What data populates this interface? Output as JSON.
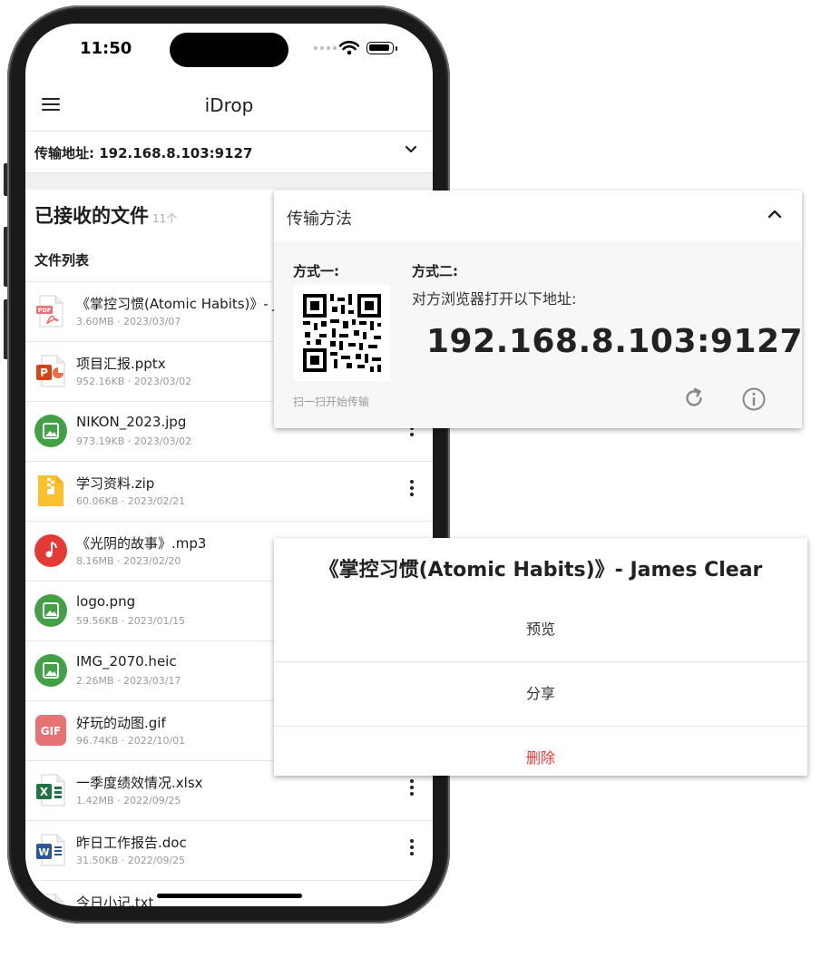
{
  "status": {
    "time": "11:50"
  },
  "app": {
    "title": "iDrop"
  },
  "address": {
    "label": "传输地址: 192.168.8.103:9127"
  },
  "received": {
    "title": "已接收的文件",
    "count": "11个",
    "list_header": "文件列表"
  },
  "files": [
    {
      "name": "《掌控习惯(Atomic Habits)》- James Clear.pdf",
      "meta": "3.60MB · 2023/03/07",
      "icon": "pdf-file-icon"
    },
    {
      "name": "项目汇报.pptx",
      "meta": "952.16KB · 2023/03/02",
      "icon": "pptx-file-icon"
    },
    {
      "name": "NIKON_2023.jpg",
      "meta": "973.19KB · 2023/03/02",
      "icon": "image-file-icon"
    },
    {
      "name": "学习资料.zip",
      "meta": "60.06KB · 2023/02/21",
      "icon": "zip-file-icon"
    },
    {
      "name": "《光阴的故事》.mp3",
      "meta": "8.16MB · 2023/02/20",
      "icon": "music-file-icon"
    },
    {
      "name": "logo.png",
      "meta": "59.56KB · 2023/01/15",
      "icon": "image-file-icon"
    },
    {
      "name": "IMG_2070.heic",
      "meta": "2.26MB · 2023/03/17",
      "icon": "image-file-icon"
    },
    {
      "name": "好玩的动图.gif",
      "meta": "96.74KB · 2022/10/01",
      "icon": "gif-file-icon"
    },
    {
      "name": "一季度绩效情况.xlsx",
      "meta": "1.42MB · 2022/09/25",
      "icon": "xlsx-file-icon"
    },
    {
      "name": "昨日工作报告.doc",
      "meta": "31.50KB · 2022/09/25",
      "icon": "doc-file-icon"
    },
    {
      "name": "今日小记.txt",
      "meta": "",
      "icon": "txt-file-icon"
    }
  ],
  "transfer": {
    "title": "传输方法",
    "method1_label": "方式一:",
    "qr_caption": "扫一扫开始传输",
    "method2_label": "方式二:",
    "method2_desc": "对方浏览器打开以下地址:",
    "address": "192.168.8.103:9127"
  },
  "action_sheet": {
    "title": "《掌控习惯(Atomic Habits)》- James Clear",
    "preview": "预览",
    "share": "分享",
    "delete": "删除"
  },
  "colors": {
    "pdf": "#e57373",
    "pptx": "#d84315",
    "image": "#43a047",
    "zip": "#fbc02d",
    "music": "#e53935",
    "gif": "#e57373",
    "xlsx": "#217346",
    "doc": "#2b579a",
    "danger": "#e53935"
  }
}
